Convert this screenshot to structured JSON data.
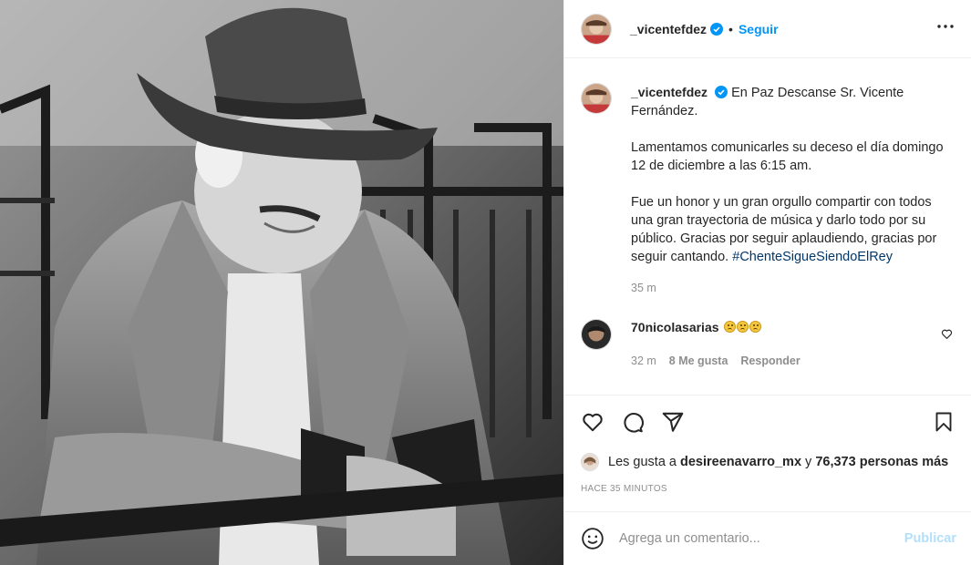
{
  "post": {
    "username": "_vicentefdez",
    "follow_label": "Seguir",
    "separator": "•",
    "photo_alt": "black-and-white portrait of a man in a cowboy hat leaning on a fence"
  },
  "caption": {
    "username": "_vicentefdez",
    "line1": "En Paz Descanse Sr. Vicente Fernández.",
    "para2": "Lamentamos comunicarles su deceso el día domingo 12 de diciembre a las 6:15 am.",
    "para3": "Fue un honor y un gran orgullo compartir con todos una gran trayectoria de música y darlo todo por su público. Gracias por seguir aplaudiendo, gracias por seguir cantando.",
    "hashtag": "#ChenteSigueSiendoElRey",
    "time": "35 m"
  },
  "comment": {
    "username": "70nicolasarias",
    "emoji_count": 3,
    "time": "32 m",
    "likes": "8 Me gusta",
    "reply": "Responder"
  },
  "likes": {
    "prefix": "Les gusta a",
    "user": "desireenavarro_mx",
    "middle": "y",
    "count": "76,373 personas más"
  },
  "ago": "HACE 35 MINUTOS",
  "add_comment": {
    "placeholder": "Agrega un comentario...",
    "publish": "Publicar"
  },
  "colors": {
    "accent": "#0095f6",
    "hashtag": "#00376b",
    "muted": "#8e8e8e",
    "publish_disabled": "#b2dffc"
  }
}
